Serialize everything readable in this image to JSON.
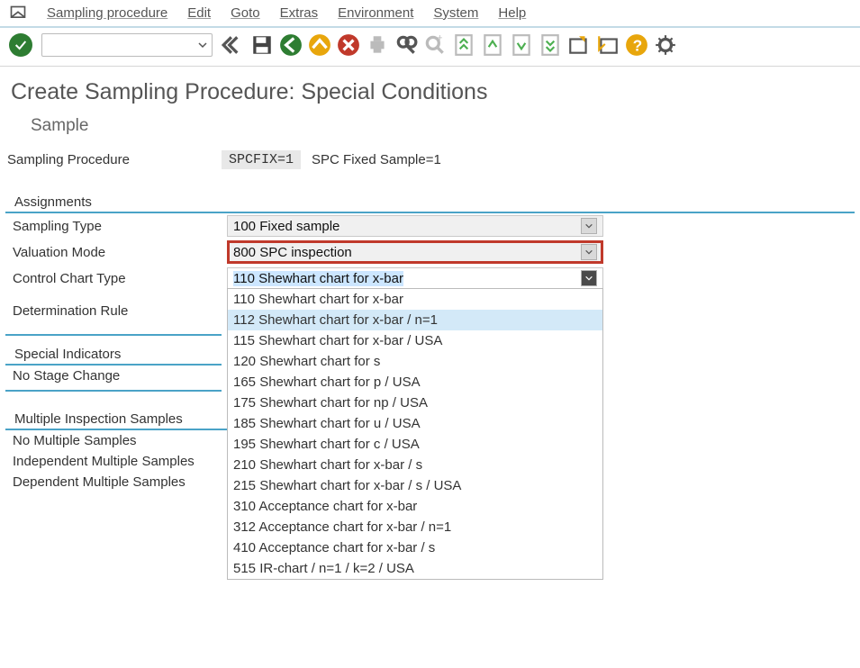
{
  "menu": {
    "items": [
      "Sampling procedure",
      "Edit",
      "Goto",
      "Extras",
      "Environment",
      "System",
      "Help"
    ]
  },
  "title": "Create Sampling Procedure: Special Conditions",
  "subtitle": "Sample",
  "sampling_procedure": {
    "label": "Sampling Procedure",
    "code": "SPCFIX=1",
    "desc": "SPC Fixed Sample=1"
  },
  "sections": {
    "assignments": "Assignments",
    "special_indicators": "Special Indicators",
    "multiple_inspection": "Multiple Inspection Samples"
  },
  "fields": {
    "sampling_type": {
      "label": "Sampling Type",
      "value": "100 Fixed sample"
    },
    "valuation_mode": {
      "label": "Valuation Mode",
      "value": "800 SPC inspection"
    },
    "control_chart_type": {
      "label": "Control Chart Type",
      "value": "110 Shewhart chart for x-bar"
    },
    "determination_rule": {
      "label": "Determination Rule"
    }
  },
  "dropdown_options": [
    "110 Shewhart chart for x-bar",
    "112 Shewhart chart for x-bar / n=1",
    "115 Shewhart chart for x-bar / USA",
    "120 Shewhart chart for s",
    "165 Shewhart chart for p / USA",
    "175 Shewhart chart for np / USA",
    "185 Shewhart chart for u / USA",
    "195 Shewhart chart for c / USA",
    "210 Shewhart chart for x-bar / s",
    "215 Shewhart chart for x-bar / s / USA",
    "310 Acceptance chart for x-bar",
    "312 Acceptance chart for x-bar / n=1",
    "410 Acceptance chart for x-bar / s",
    "515 IR-chart / n=1 / k=2 / USA"
  ],
  "dropdown_selected_index": 1,
  "special": {
    "no_stage_change": "No Stage Change"
  },
  "multiple": {
    "no_multiple": "No Multiple Samples",
    "independent": "Independent Multiple Samples",
    "dependent": "Dependent Multiple Samples"
  }
}
